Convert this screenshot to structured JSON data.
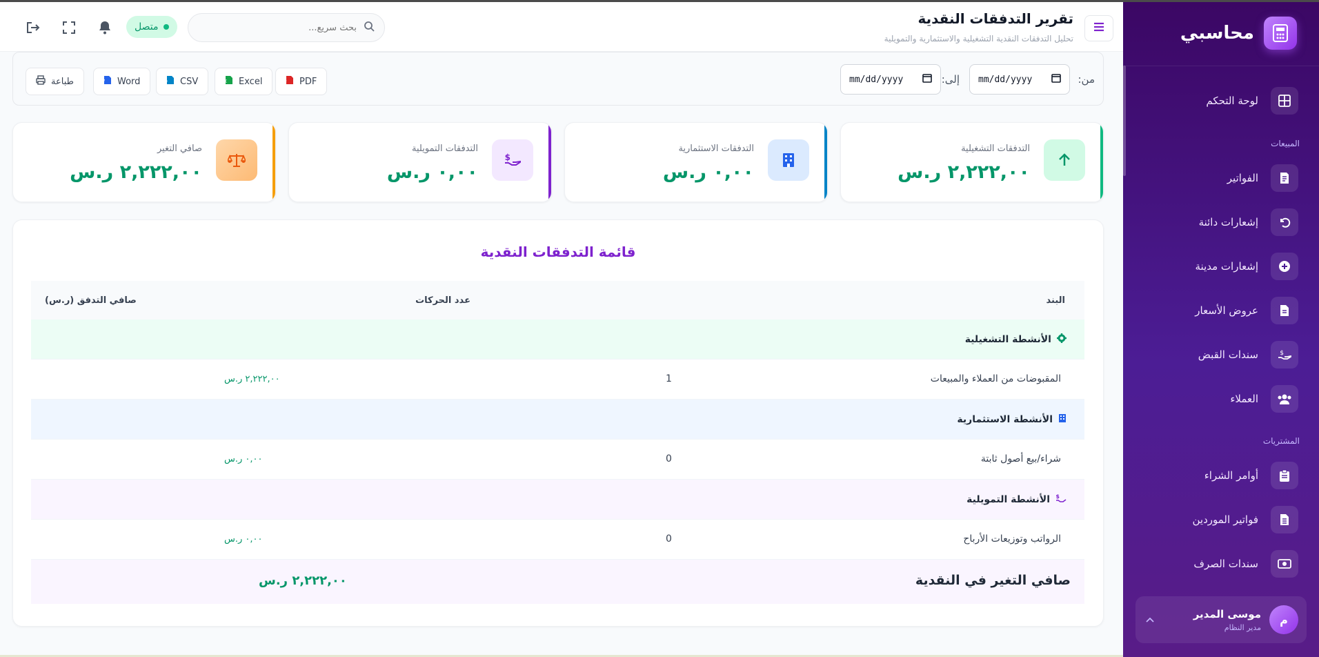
{
  "app": {
    "brand": "محاسبي"
  },
  "sidebar": {
    "items": [
      {
        "label": "لوحة التحكم",
        "icon": "grid-icon"
      },
      {
        "section": "المبيعات"
      },
      {
        "label": "الفواتير",
        "icon": "invoice-icon"
      },
      {
        "label": "إشعارات دائنة",
        "icon": "undo-icon"
      },
      {
        "label": "إشعارات مدينة",
        "icon": "plus-circle-icon"
      },
      {
        "label": "عروض الأسعار",
        "icon": "document-icon"
      },
      {
        "label": "سندات القبض",
        "icon": "hand-money-icon"
      },
      {
        "label": "العملاء",
        "icon": "users-icon"
      },
      {
        "section": "المشتريات"
      },
      {
        "label": "أوامر الشراء",
        "icon": "clipboard-icon"
      },
      {
        "label": "فواتير الموردين",
        "icon": "file-invoice-icon"
      },
      {
        "label": "سندات الصرف",
        "icon": "money-bill-icon"
      }
    ],
    "sections": {
      "sales": "المبيعات",
      "purchases": "المشتريات"
    },
    "user": {
      "initial": "م",
      "name": "موسى المدير",
      "role": "مدير النظام"
    }
  },
  "header": {
    "title": "تقرير التدفقات النقدية",
    "subtitle": "تحليل التدفقات النقدية التشغيلية والاستثمارية والتمويلية",
    "search_placeholder": "بحث سريع...",
    "status": "متصل"
  },
  "filters": {
    "from_label": "من:",
    "to_label": "إلى:",
    "from_value": "mm/dd/yyyy",
    "to_value": "mm/dd/yyyy"
  },
  "export": {
    "pdf": "PDF",
    "excel": "Excel",
    "csv": "CSV",
    "word": "Word",
    "print": "طباعة"
  },
  "cards": [
    {
      "label": "التدفقات التشغيلية",
      "value": "٢,٢٢٢,٠٠ ر.س",
      "color": "#10b981"
    },
    {
      "label": "التدفقات الاستثمارية",
      "value": "٠,٠٠ ر.س",
      "color": "#0284c7"
    },
    {
      "label": "التدفقات التمويلية",
      "value": "٠,٠٠ ر.س",
      "color": "#7e22ce"
    },
    {
      "label": "صافي التغير",
      "value": "٢,٢٢٢,٠٠ ر.س",
      "color": "#f59e0b"
    }
  ],
  "statement": {
    "title": "قائمة التدفقات النقدية",
    "columns": {
      "item": "البند",
      "count": "عدد الحركات",
      "net": "صافي التدفق (ر.س)"
    },
    "sections": [
      {
        "label": "الأنشطة التشغيلية",
        "item": "المقبوضات من العملاء والمبيعات",
        "count": "1",
        "value": "٢,٢٢٢,٠٠ ر.س"
      },
      {
        "label": "الأنشطة الاستثمارية",
        "item": "شراء/بيع أصول ثابتة",
        "count": "0",
        "value": "٠,٠٠ ر.س"
      },
      {
        "label": "الأنشطة التمويلية",
        "item": "الرواتب وتوزيعات الأرباح",
        "count": "0",
        "value": "٠,٠٠ ر.س"
      }
    ],
    "total": {
      "label": "صافي التغير في النقدية",
      "value": "٢,٢٢٢,٠٠ ر.س"
    }
  },
  "colors": {
    "accent": "#7e22ce",
    "positive": "#059669",
    "sidebar": "#3b0764"
  }
}
